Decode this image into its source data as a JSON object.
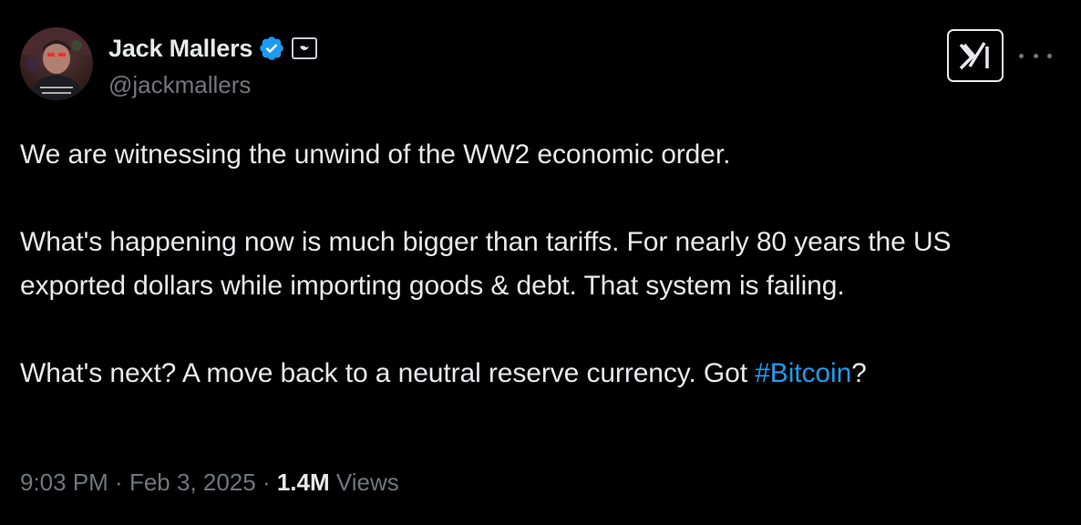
{
  "author": {
    "display_name": "Jack Mallers",
    "handle": "@jackmallers",
    "verified": true
  },
  "tweet": {
    "line1": "We are witnessing the unwind of the WW2 economic order.",
    "para2": "What's happening now is much bigger than tariffs. For nearly 80 years the US exported dollars while importing goods & debt. That system is failing.",
    "para3_prefix": "What's next? A move back to a neutral reserve currency. Got ",
    "hashtag": "#Bitcoin",
    "para3_suffix": "?"
  },
  "meta": {
    "time": "9:03 PM",
    "sep1": " · ",
    "date": "Feb 3, 2025",
    "sep2": " · ",
    "views_count": "1.4M",
    "views_label": " Views"
  },
  "colors": {
    "background": "#000000",
    "text": "#e7e9ea",
    "muted": "#71767b",
    "link": "#1d9bf0",
    "verified": "#1d9bf0"
  },
  "icons": {
    "verified": "verified-badge-icon",
    "affiliate": "affiliate-badge-icon",
    "brand": "xai-logo-icon",
    "more": "more-horizontal-icon"
  }
}
